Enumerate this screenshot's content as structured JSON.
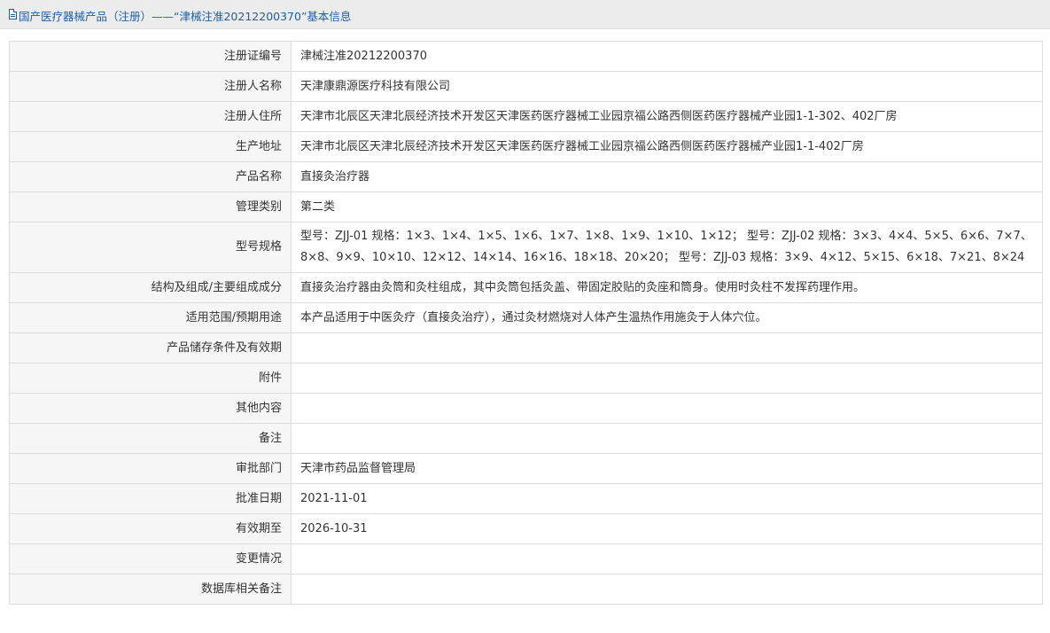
{
  "header": {
    "breadcrumb": "国产医疗器械产品（注册）——“津械注准20212200370”基本信息"
  },
  "rows": [
    {
      "label": "注册证编号",
      "value": "津械注准20212200370"
    },
    {
      "label": "注册人名称",
      "value": "天津康鼎源医疗科技有限公司"
    },
    {
      "label": "注册人住所",
      "value": "天津市北辰区天津北辰经济技术开发区天津医药医疗器械工业园京福公路西侧医药医疗器械产业园1-1-302、402厂房"
    },
    {
      "label": "生产地址",
      "value": "天津市北辰区天津北辰经济技术开发区天津医药医疗器械工业园京福公路西侧医药医疗器械产业园1-1-402厂房"
    },
    {
      "label": "产品名称",
      "value": "直接灸治疗器"
    },
    {
      "label": "管理类别",
      "value": "第二类"
    },
    {
      "label": "型号规格",
      "value": "型号：ZJJ-01 规格：1×3、1×4、1×5、1×6、1×7、1×8、1×9、1×10、1×12； 型号：ZJJ-02 规格：3×3、4×4、5×5、6×6、7×7、8×8、9×9、10×10、12×12、14×14、16×16、18×18、20×20； 型号：ZJJ-03 规格：3×9、4×12、5×15、6×18、7×21、8×24"
    },
    {
      "label": "结构及组成/主要组成成分",
      "value": "直接灸治疗器由灸筒和灸柱组成，其中灸筒包括灸盖、带固定胶贴的灸座和筒身。使用时灸柱不发挥药理作用。"
    },
    {
      "label": "适用范围/预期用途",
      "value": "本产品适用于中医灸疗（直接灸治疗），通过灸材燃烧对人体产生温热作用施灸于人体穴位。"
    },
    {
      "label": "产品储存条件及有效期",
      "value": ""
    },
    {
      "label": "附件",
      "value": ""
    },
    {
      "label": "其他内容",
      "value": ""
    },
    {
      "label": "备注",
      "value": ""
    },
    {
      "label": "审批部门",
      "value": "天津市药品监督管理局"
    },
    {
      "label": "批准日期",
      "value": "2021-11-01"
    },
    {
      "label": "有效期至",
      "value": "2026-10-31"
    },
    {
      "label": "变更情况",
      "value": ""
    },
    {
      "label": "数据库相关备注",
      "value": ""
    }
  ]
}
